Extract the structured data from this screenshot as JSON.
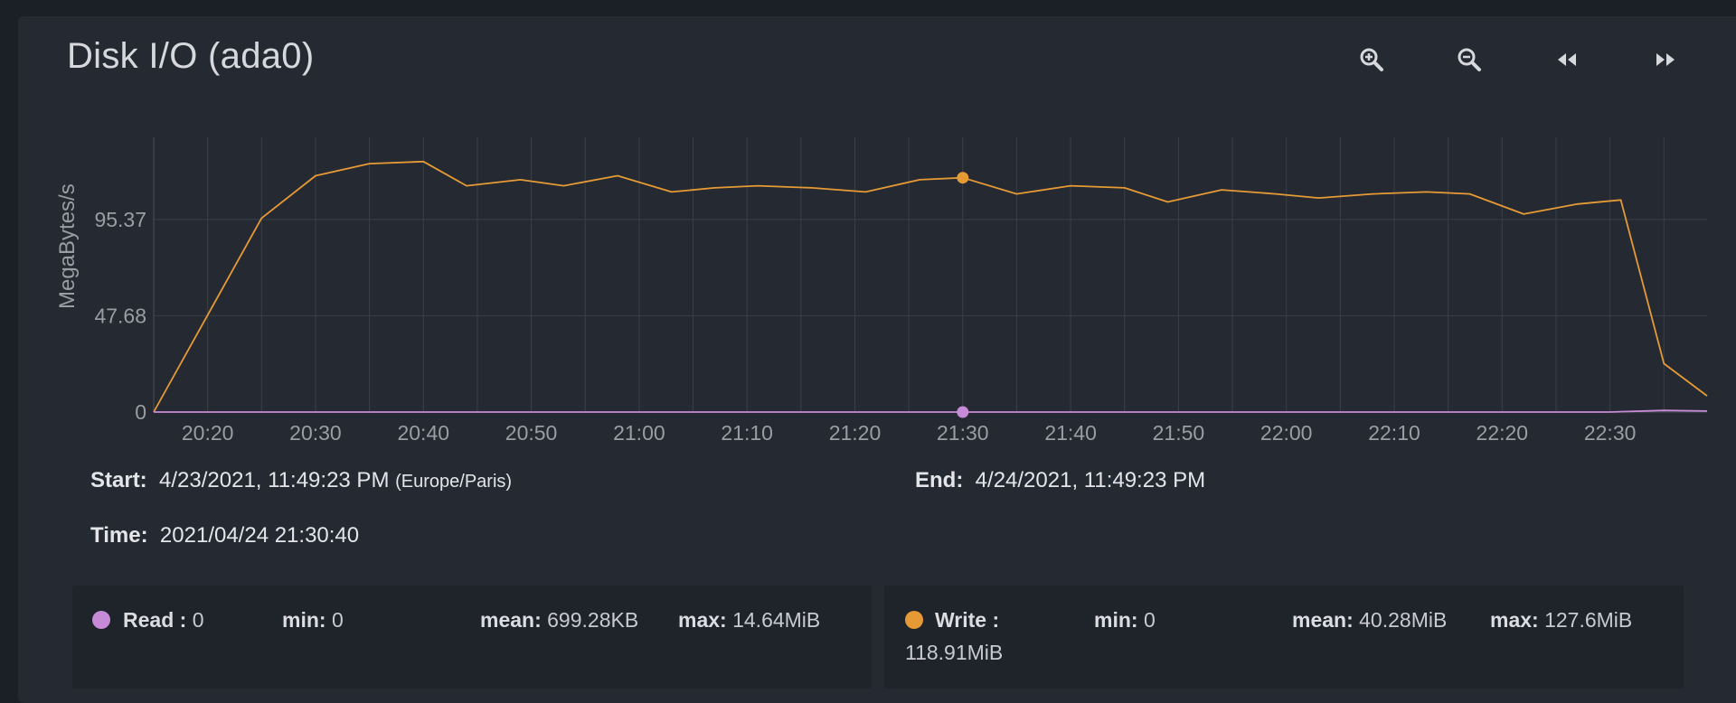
{
  "title": "Disk I/O (ada0)",
  "toolbar": {
    "zoom_in": "zoom-in-icon",
    "zoom_out": "zoom-out-icon",
    "back": "rewind-icon",
    "forward": "fast-forward-icon"
  },
  "colors": {
    "read": "#c68ad6",
    "write": "#e69a35",
    "grid": "#3a3f47",
    "tick": "#9a9da3"
  },
  "chart_data": {
    "type": "line",
    "ylabel": "MegaBytes/s",
    "yticks": [
      0,
      47.68,
      95.37
    ],
    "ytick_labels": [
      "0",
      "47.68",
      "95.37"
    ],
    "ylim": [
      0,
      136
    ],
    "xlim": [
      "20:15",
      "22:39"
    ],
    "xtick_labels": [
      "20:20",
      "20:30",
      "20:40",
      "20:50",
      "21:00",
      "21:10",
      "21:20",
      "21:30",
      "21:40",
      "21:50",
      "22:00",
      "22:10",
      "22:20",
      "22:30"
    ],
    "grid": true,
    "cursor_time": "21:30",
    "series": [
      {
        "name": "Write",
        "color": "#e69a35",
        "x": [
          "20:15",
          "20:25",
          "20:30",
          "20:35",
          "20:40",
          "20:44",
          "20:49",
          "20:53",
          "20:58",
          "21:03",
          "21:07",
          "21:11",
          "21:16",
          "21:21",
          "21:26",
          "21:30",
          "21:35",
          "21:40",
          "21:45",
          "21:49",
          "21:54",
          "21:59",
          "22:03",
          "22:08",
          "22:13",
          "22:17",
          "22:22",
          "22:27",
          "22:31",
          "22:35",
          "22:39"
        ],
        "values": [
          0,
          96,
          117,
          123,
          124,
          112,
          115,
          112,
          117,
          109,
          111,
          112,
          111,
          109,
          115,
          116,
          108,
          112,
          111,
          104,
          110,
          108,
          106,
          108,
          109,
          108,
          98,
          103,
          105,
          24,
          8
        ]
      },
      {
        "name": "Read",
        "color": "#c68ad6",
        "x": [
          "20:15",
          "21:30",
          "22:30",
          "22:35",
          "22:39"
        ],
        "values": [
          0,
          0,
          0,
          0.8,
          0.5
        ]
      }
    ]
  },
  "info": {
    "start_label": "Start:",
    "start_value": "4/23/2021, 11:49:23 PM",
    "start_tz": "(Europe/Paris)",
    "end_label": "End:",
    "end_value": "4/24/2021, 11:49:23 PM",
    "time_label": "Time:",
    "time_value": "2021/04/24 21:30:40"
  },
  "legend": {
    "read": {
      "label": "Read :",
      "value": "0",
      "min_label": "min:",
      "min": "0",
      "mean_label": "mean:",
      "mean": "699.28KB",
      "max_label": "max:",
      "max": "14.64MiB"
    },
    "write": {
      "label": "Write :",
      "value": "118.91MiB",
      "min_label": "min:",
      "min": "0",
      "mean_label": "mean:",
      "mean": "40.28MiB",
      "max_label": "max:",
      "max": "127.6MiB"
    }
  }
}
